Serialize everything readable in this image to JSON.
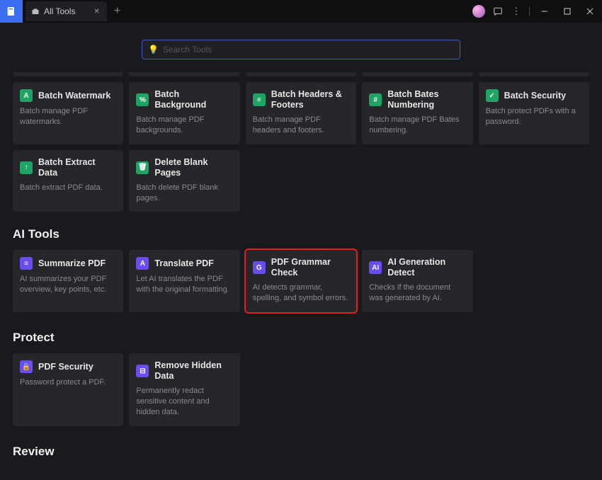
{
  "titlebar": {
    "tab_label": "All Tools"
  },
  "search": {
    "placeholder": "Search Tools"
  },
  "sections": {
    "batch": {
      "cards": [
        {
          "title": "Batch Watermark",
          "desc": "Batch manage PDF watermarks.",
          "icon": "A",
          "color": "green"
        },
        {
          "title": "Batch Background",
          "desc": "Batch manage PDF backgrounds.",
          "icon": "%",
          "color": "green"
        },
        {
          "title": "Batch Headers & Footers",
          "desc": "Batch manage PDF headers and footers.",
          "icon": "≡",
          "color": "green"
        },
        {
          "title": "Batch Bates Numbering",
          "desc": "Batch manage PDF Bates numbering.",
          "icon": "#",
          "color": "green"
        },
        {
          "title": "Batch Security",
          "desc": "Batch protect PDFs with a password.",
          "icon": "✓",
          "color": "green"
        },
        {
          "title": "Batch Extract Data",
          "desc": "Batch extract PDF data.",
          "icon": "↑",
          "color": "green"
        },
        {
          "title": "Delete Blank Pages",
          "desc": "Batch delete PDF blank pages.",
          "icon": "🗑",
          "color": "green"
        }
      ]
    },
    "ai": {
      "title": "AI Tools",
      "cards": [
        {
          "title": "Summarize PDF",
          "desc": "AI summarizes your PDF overview, key points, etc.",
          "icon": "≡",
          "color": "purple"
        },
        {
          "title": "Translate PDF",
          "desc": "Let AI translates the PDF with the original formatting.",
          "icon": "A",
          "color": "purple"
        },
        {
          "title": "PDF Grammar Check",
          "desc": "AI detects grammar, spelling, and symbol errors.",
          "icon": "G",
          "color": "purple",
          "highlight": true
        },
        {
          "title": "AI Generation Detect",
          "desc": "Checks if the document was generated by AI.",
          "icon": "AI",
          "color": "purple"
        }
      ]
    },
    "protect": {
      "title": "Protect",
      "cards": [
        {
          "title": "PDF Security",
          "desc": "Password protect a PDF.",
          "icon": "🔒",
          "color": "purple"
        },
        {
          "title": "Remove Hidden Data",
          "desc": "Permanently redact sensitive content and hidden data.",
          "icon": "⊟",
          "color": "purple"
        }
      ]
    },
    "review": {
      "title": "Review"
    }
  }
}
